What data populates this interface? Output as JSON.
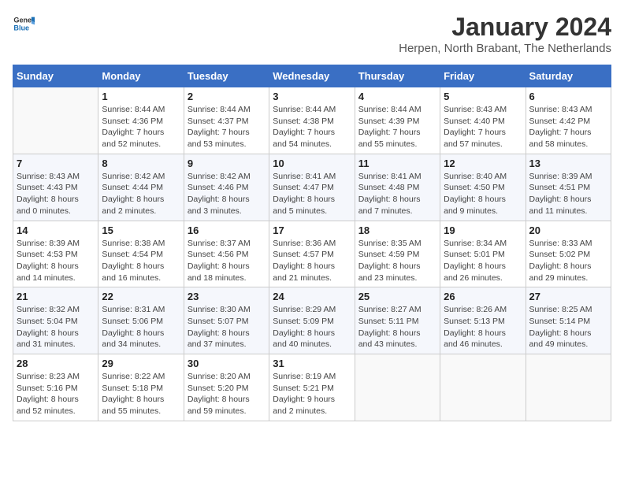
{
  "header": {
    "logo_line1": "General",
    "logo_line2": "Blue",
    "title": "January 2024",
    "subtitle": "Herpen, North Brabant, The Netherlands"
  },
  "days_of_week": [
    "Sunday",
    "Monday",
    "Tuesday",
    "Wednesday",
    "Thursday",
    "Friday",
    "Saturday"
  ],
  "weeks": [
    [
      {
        "day": "",
        "info": ""
      },
      {
        "day": "1",
        "info": "Sunrise: 8:44 AM\nSunset: 4:36 PM\nDaylight: 7 hours\nand 52 minutes."
      },
      {
        "day": "2",
        "info": "Sunrise: 8:44 AM\nSunset: 4:37 PM\nDaylight: 7 hours\nand 53 minutes."
      },
      {
        "day": "3",
        "info": "Sunrise: 8:44 AM\nSunset: 4:38 PM\nDaylight: 7 hours\nand 54 minutes."
      },
      {
        "day": "4",
        "info": "Sunrise: 8:44 AM\nSunset: 4:39 PM\nDaylight: 7 hours\nand 55 minutes."
      },
      {
        "day": "5",
        "info": "Sunrise: 8:43 AM\nSunset: 4:40 PM\nDaylight: 7 hours\nand 57 minutes."
      },
      {
        "day": "6",
        "info": "Sunrise: 8:43 AM\nSunset: 4:42 PM\nDaylight: 7 hours\nand 58 minutes."
      }
    ],
    [
      {
        "day": "7",
        "info": "Sunrise: 8:43 AM\nSunset: 4:43 PM\nDaylight: 8 hours\nand 0 minutes."
      },
      {
        "day": "8",
        "info": "Sunrise: 8:42 AM\nSunset: 4:44 PM\nDaylight: 8 hours\nand 2 minutes."
      },
      {
        "day": "9",
        "info": "Sunrise: 8:42 AM\nSunset: 4:46 PM\nDaylight: 8 hours\nand 3 minutes."
      },
      {
        "day": "10",
        "info": "Sunrise: 8:41 AM\nSunset: 4:47 PM\nDaylight: 8 hours\nand 5 minutes."
      },
      {
        "day": "11",
        "info": "Sunrise: 8:41 AM\nSunset: 4:48 PM\nDaylight: 8 hours\nand 7 minutes."
      },
      {
        "day": "12",
        "info": "Sunrise: 8:40 AM\nSunset: 4:50 PM\nDaylight: 8 hours\nand 9 minutes."
      },
      {
        "day": "13",
        "info": "Sunrise: 8:39 AM\nSunset: 4:51 PM\nDaylight: 8 hours\nand 11 minutes."
      }
    ],
    [
      {
        "day": "14",
        "info": "Sunrise: 8:39 AM\nSunset: 4:53 PM\nDaylight: 8 hours\nand 14 minutes."
      },
      {
        "day": "15",
        "info": "Sunrise: 8:38 AM\nSunset: 4:54 PM\nDaylight: 8 hours\nand 16 minutes."
      },
      {
        "day": "16",
        "info": "Sunrise: 8:37 AM\nSunset: 4:56 PM\nDaylight: 8 hours\nand 18 minutes."
      },
      {
        "day": "17",
        "info": "Sunrise: 8:36 AM\nSunset: 4:57 PM\nDaylight: 8 hours\nand 21 minutes."
      },
      {
        "day": "18",
        "info": "Sunrise: 8:35 AM\nSunset: 4:59 PM\nDaylight: 8 hours\nand 23 minutes."
      },
      {
        "day": "19",
        "info": "Sunrise: 8:34 AM\nSunset: 5:01 PM\nDaylight: 8 hours\nand 26 minutes."
      },
      {
        "day": "20",
        "info": "Sunrise: 8:33 AM\nSunset: 5:02 PM\nDaylight: 8 hours\nand 29 minutes."
      }
    ],
    [
      {
        "day": "21",
        "info": "Sunrise: 8:32 AM\nSunset: 5:04 PM\nDaylight: 8 hours\nand 31 minutes."
      },
      {
        "day": "22",
        "info": "Sunrise: 8:31 AM\nSunset: 5:06 PM\nDaylight: 8 hours\nand 34 minutes."
      },
      {
        "day": "23",
        "info": "Sunrise: 8:30 AM\nSunset: 5:07 PM\nDaylight: 8 hours\nand 37 minutes."
      },
      {
        "day": "24",
        "info": "Sunrise: 8:29 AM\nSunset: 5:09 PM\nDaylight: 8 hours\nand 40 minutes."
      },
      {
        "day": "25",
        "info": "Sunrise: 8:27 AM\nSunset: 5:11 PM\nDaylight: 8 hours\nand 43 minutes."
      },
      {
        "day": "26",
        "info": "Sunrise: 8:26 AM\nSunset: 5:13 PM\nDaylight: 8 hours\nand 46 minutes."
      },
      {
        "day": "27",
        "info": "Sunrise: 8:25 AM\nSunset: 5:14 PM\nDaylight: 8 hours\nand 49 minutes."
      }
    ],
    [
      {
        "day": "28",
        "info": "Sunrise: 8:23 AM\nSunset: 5:16 PM\nDaylight: 8 hours\nand 52 minutes."
      },
      {
        "day": "29",
        "info": "Sunrise: 8:22 AM\nSunset: 5:18 PM\nDaylight: 8 hours\nand 55 minutes."
      },
      {
        "day": "30",
        "info": "Sunrise: 8:20 AM\nSunset: 5:20 PM\nDaylight: 8 hours\nand 59 minutes."
      },
      {
        "day": "31",
        "info": "Sunrise: 8:19 AM\nSunset: 5:21 PM\nDaylight: 9 hours\nand 2 minutes."
      },
      {
        "day": "",
        "info": ""
      },
      {
        "day": "",
        "info": ""
      },
      {
        "day": "",
        "info": ""
      }
    ]
  ]
}
